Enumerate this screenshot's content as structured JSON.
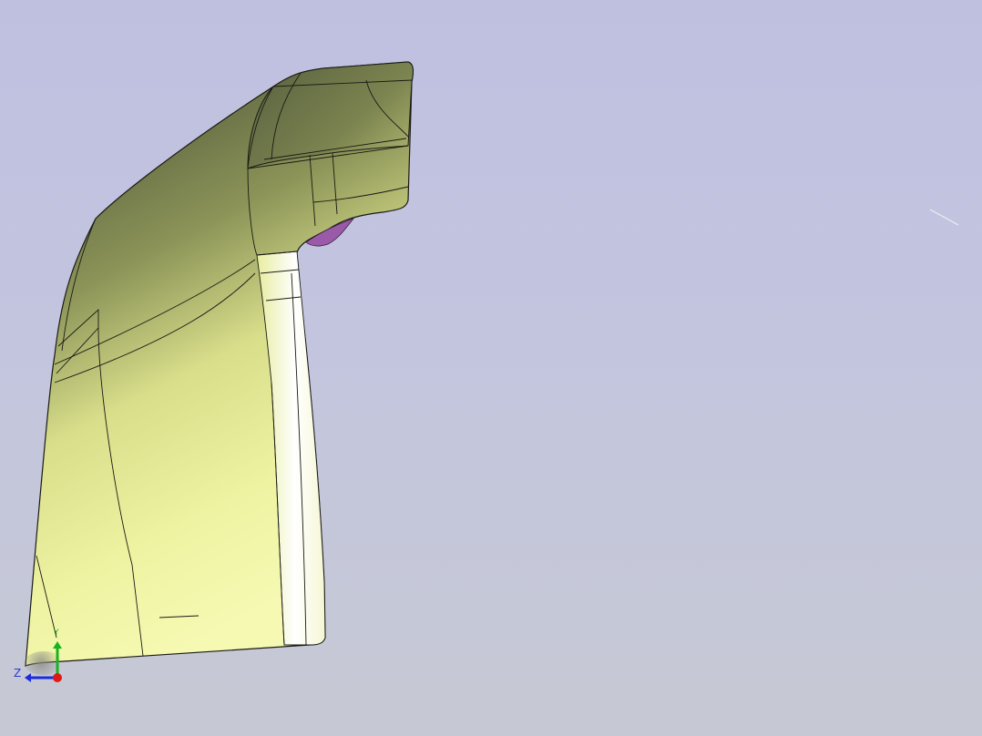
{
  "viewer": {
    "background_top": "#bfc0e0",
    "background_bottom": "#c6c9d3"
  },
  "model": {
    "shaded_color": "#f2f6a4",
    "shadow_color": "#5e6640",
    "edge_color": "#1a1a14",
    "inner_face_color": "#9a5aa8"
  },
  "triad": {
    "z_label": "Z",
    "y_label": "Y",
    "x_color": "#e01818",
    "y_color": "#19b31e",
    "z_color": "#1c2be0"
  }
}
